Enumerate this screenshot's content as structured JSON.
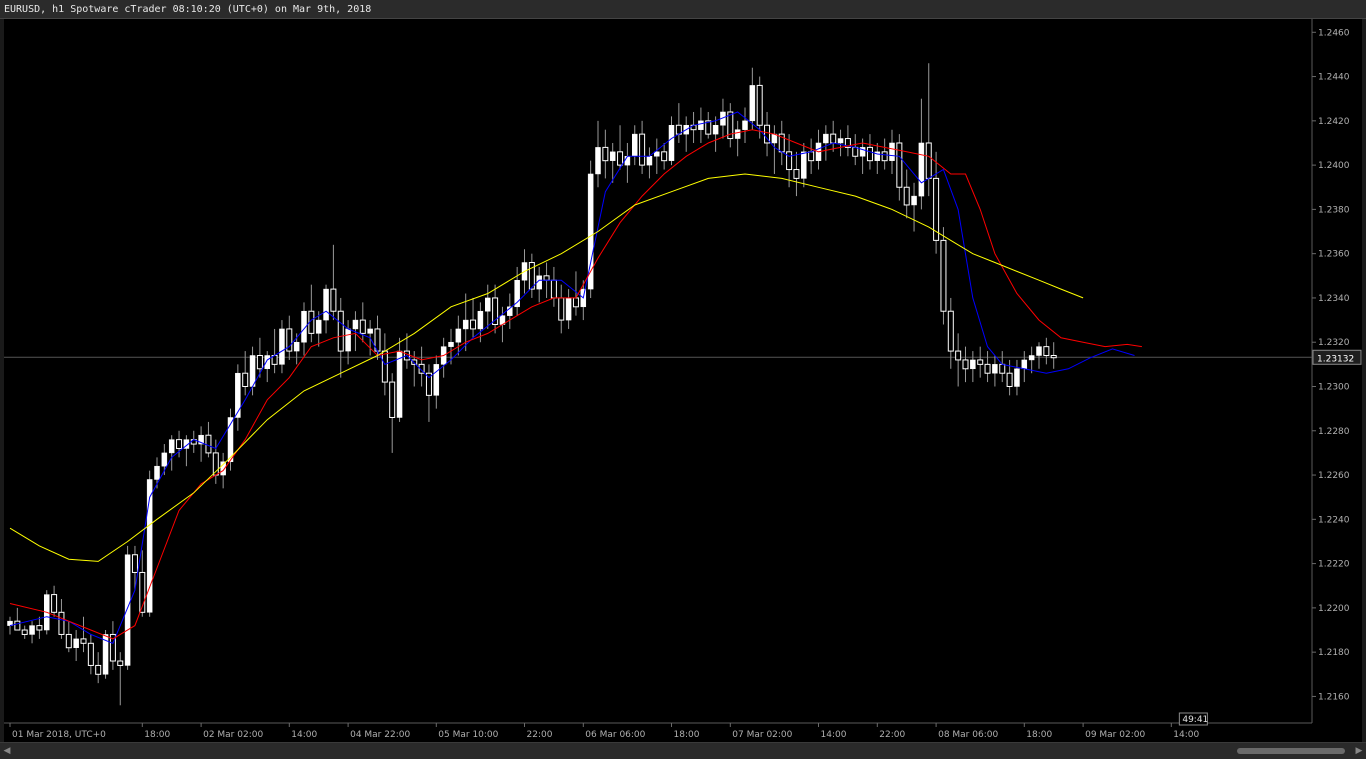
{
  "window": {
    "title": "EURUSD, h1 Spotware cTrader 08:10:20 (UTC+0) on Mar 9th, 2018"
  },
  "colors": {
    "background": "#000000",
    "up_candle": "#ffffff",
    "down_candle": "#ffffff",
    "wick": "#9a9a9a",
    "fast_ma": "#0000ff",
    "mid_ma": "#ff0000",
    "slow_ma": "#ffff00",
    "text": "#b0b0b0",
    "price_line": "#555555"
  },
  "price_label": "1.23132",
  "countdown": "49:41",
  "chart_data": {
    "type": "line",
    "title": "",
    "xlabel": "",
    "ylabel": "",
    "ylim": [
      1.2148,
      1.2466
    ],
    "x_range": [
      0,
      162
    ],
    "y_ticks": [
      "1.2460",
      "1.2440",
      "1.2420",
      "1.2400",
      "1.2380",
      "1.2360",
      "1.2340",
      "1.2320",
      "1.2300",
      "1.2280",
      "1.2260",
      "1.2240",
      "1.2220",
      "1.2200",
      "1.2180",
      "1.2160"
    ],
    "x_ticks": [
      {
        "index": 0,
        "label": "01 Mar 2018, UTC+0"
      },
      {
        "index": 18,
        "label": "18:00"
      },
      {
        "index": 26,
        "label": "02 Mar 02:00"
      },
      {
        "index": 38,
        "label": "14:00"
      },
      {
        "index": 46,
        "label": "04 Mar 22:00"
      },
      {
        "index": 58,
        "label": "05 Mar 10:00"
      },
      {
        "index": 70,
        "label": "22:00"
      },
      {
        "index": 78,
        "label": "06 Mar 06:00"
      },
      {
        "index": 90,
        "label": "18:00"
      },
      {
        "index": 98,
        "label": "07 Mar 02:00"
      },
      {
        "index": 110,
        "label": "14:00"
      },
      {
        "index": 118,
        "label": "22:00"
      },
      {
        "index": 126,
        "label": "08 Mar 06:00"
      },
      {
        "index": 138,
        "label": "18:00"
      },
      {
        "index": 146,
        "label": "09 Mar 02:00"
      },
      {
        "index": 158,
        "label": "14:00"
      }
    ],
    "current_price": 1.23132,
    "candles": [
      [
        1.2192,
        1.2196,
        1.2188,
        1.2194
      ],
      [
        1.2194,
        1.22,
        1.219,
        1.219
      ],
      [
        1.219,
        1.2192,
        1.2186,
        1.2188
      ],
      [
        1.2188,
        1.2194,
        1.2184,
        1.2192
      ],
      [
        1.2192,
        1.2196,
        1.2186,
        1.219
      ],
      [
        1.219,
        1.2208,
        1.2188,
        1.2206
      ],
      [
        1.2206,
        1.221,
        1.2196,
        1.2198
      ],
      [
        1.2198,
        1.2204,
        1.2186,
        1.2188
      ],
      [
        1.2188,
        1.2194,
        1.218,
        1.2182
      ],
      [
        1.2182,
        1.219,
        1.2176,
        1.2186
      ],
      [
        1.2186,
        1.2196,
        1.218,
        1.2184
      ],
      [
        1.2184,
        1.2188,
        1.217,
        1.2174
      ],
      [
        1.2174,
        1.218,
        1.2166,
        1.217
      ],
      [
        1.217,
        1.219,
        1.2168,
        1.2188
      ],
      [
        1.2188,
        1.2194,
        1.2172,
        1.2176
      ],
      [
        1.2176,
        1.218,
        1.2156,
        1.2174
      ],
      [
        1.2174,
        1.2228,
        1.2172,
        1.2224
      ],
      [
        1.2224,
        1.2228,
        1.2208,
        1.2216
      ],
      [
        1.2216,
        1.2226,
        1.2196,
        1.2198
      ],
      [
        1.2198,
        1.2262,
        1.2196,
        1.2258
      ],
      [
        1.2258,
        1.2268,
        1.2254,
        1.2264
      ],
      [
        1.2264,
        1.2274,
        1.226,
        1.227
      ],
      [
        1.227,
        1.2278,
        1.2262,
        1.2276
      ],
      [
        1.2276,
        1.228,
        1.2268,
        1.2272
      ],
      [
        1.2272,
        1.2278,
        1.2264,
        1.2276
      ],
      [
        1.2276,
        1.228,
        1.227,
        1.2274
      ],
      [
        1.2274,
        1.2282,
        1.2266,
        1.2278
      ],
      [
        1.2278,
        1.2284,
        1.2268,
        1.227
      ],
      [
        1.227,
        1.2276,
        1.2256,
        1.226
      ],
      [
        1.226,
        1.227,
        1.2254,
        1.2266
      ],
      [
        1.2266,
        1.229,
        1.2262,
        1.2286
      ],
      [
        1.2286,
        1.231,
        1.228,
        1.2306
      ],
      [
        1.2306,
        1.2316,
        1.2296,
        1.23
      ],
      [
        1.23,
        1.2318,
        1.2296,
        1.2314
      ],
      [
        1.2314,
        1.2322,
        1.2304,
        1.2308
      ],
      [
        1.2308,
        1.2316,
        1.2302,
        1.2314
      ],
      [
        1.2314,
        1.2326,
        1.2306,
        1.231
      ],
      [
        1.231,
        1.233,
        1.2306,
        1.2326
      ],
      [
        1.2326,
        1.2332,
        1.2312,
        1.2316
      ],
      [
        1.2316,
        1.2324,
        1.231,
        1.232
      ],
      [
        1.232,
        1.2338,
        1.2314,
        1.2334
      ],
      [
        1.2334,
        1.2346,
        1.232,
        1.2324
      ],
      [
        1.2324,
        1.2334,
        1.2318,
        1.233
      ],
      [
        1.233,
        1.2346,
        1.2324,
        1.2344
      ],
      [
        1.2344,
        1.2364,
        1.233,
        1.2334
      ],
      [
        1.2334,
        1.234,
        1.2304,
        1.2316
      ],
      [
        1.2316,
        1.233,
        1.231,
        1.2326
      ],
      [
        1.2326,
        1.2334,
        1.2316,
        1.233
      ],
      [
        1.233,
        1.2338,
        1.232,
        1.2324
      ],
      [
        1.2324,
        1.233,
        1.2314,
        1.2326
      ],
      [
        1.2326,
        1.2332,
        1.2312,
        1.2316
      ],
      [
        1.2316,
        1.2324,
        1.2296,
        1.2302
      ],
      [
        1.2302,
        1.2306,
        1.227,
        1.2286
      ],
      [
        1.2286,
        1.2322,
        1.2284,
        1.2316
      ],
      [
        1.2316,
        1.2324,
        1.2308,
        1.2312
      ],
      [
        1.2312,
        1.2316,
        1.23,
        1.231
      ],
      [
        1.231,
        1.2318,
        1.23,
        1.2306
      ],
      [
        1.2306,
        1.231,
        1.2284,
        1.2296
      ],
      [
        1.2296,
        1.2314,
        1.229,
        1.231
      ],
      [
        1.231,
        1.2322,
        1.2304,
        1.2318
      ],
      [
        1.2318,
        1.2326,
        1.231,
        1.232
      ],
      [
        1.232,
        1.2332,
        1.2314,
        1.2326
      ],
      [
        1.2326,
        1.2342,
        1.2316,
        1.233
      ],
      [
        1.233,
        1.234,
        1.2322,
        1.2326
      ],
      [
        1.2326,
        1.2338,
        1.232,
        1.2334
      ],
      [
        1.2334,
        1.2346,
        1.2326,
        1.234
      ],
      [
        1.234,
        1.2346,
        1.2324,
        1.2328
      ],
      [
        1.2328,
        1.2336,
        1.232,
        1.2332
      ],
      [
        1.2332,
        1.2342,
        1.2326,
        1.2336
      ],
      [
        1.2336,
        1.2354,
        1.2332,
        1.2348
      ],
      [
        1.2348,
        1.2362,
        1.2342,
        1.2356
      ],
      [
        1.2356,
        1.236,
        1.234,
        1.2344
      ],
      [
        1.2344,
        1.2354,
        1.2338,
        1.235
      ],
      [
        1.235,
        1.2356,
        1.234,
        1.2348
      ],
      [
        1.2348,
        1.2354,
        1.2336,
        1.234
      ],
      [
        1.234,
        1.2346,
        1.2324,
        1.233
      ],
      [
        1.233,
        1.2344,
        1.2326,
        1.234
      ],
      [
        1.234,
        1.2352,
        1.2332,
        1.2336
      ],
      [
        1.2336,
        1.2348,
        1.233,
        1.2344
      ],
      [
        1.2344,
        1.2402,
        1.234,
        1.2396
      ],
      [
        1.2396,
        1.242,
        1.239,
        1.2408
      ],
      [
        1.2408,
        1.2416,
        1.2394,
        1.2402
      ],
      [
        1.2402,
        1.241,
        1.2392,
        1.2406
      ],
      [
        1.2406,
        1.2418,
        1.2398,
        1.24
      ],
      [
        1.24,
        1.241,
        1.2392,
        1.2404
      ],
      [
        1.2404,
        1.2418,
        1.24,
        1.2414
      ],
      [
        1.2414,
        1.242,
        1.2396,
        1.24
      ],
      [
        1.24,
        1.2408,
        1.2394,
        1.2404
      ],
      [
        1.2404,
        1.2412,
        1.2396,
        1.2406
      ],
      [
        1.2406,
        1.241,
        1.2398,
        1.2402
      ],
      [
        1.2402,
        1.2422,
        1.24,
        1.2418
      ],
      [
        1.2418,
        1.2428,
        1.241,
        1.2414
      ],
      [
        1.2414,
        1.2422,
        1.2406,
        1.2418
      ],
      [
        1.2418,
        1.2424,
        1.241,
        1.2416
      ],
      [
        1.2416,
        1.2426,
        1.241,
        1.242
      ],
      [
        1.242,
        1.2424,
        1.2412,
        1.2414
      ],
      [
        1.2414,
        1.2422,
        1.2406,
        1.2418
      ],
      [
        1.2418,
        1.243,
        1.2412,
        1.2424
      ],
      [
        1.2424,
        1.2428,
        1.2408,
        1.2412
      ],
      [
        1.2412,
        1.242,
        1.2404,
        1.2416
      ],
      [
        1.2416,
        1.2426,
        1.241,
        1.242
      ],
      [
        1.242,
        1.2444,
        1.2416,
        1.2436
      ],
      [
        1.2436,
        1.244,
        1.2412,
        1.2418
      ],
      [
        1.2418,
        1.2424,
        1.2404,
        1.241
      ],
      [
        1.241,
        1.2418,
        1.2396,
        1.2414
      ],
      [
        1.2414,
        1.242,
        1.24,
        1.2406
      ],
      [
        1.2406,
        1.2414,
        1.239,
        1.2398
      ],
      [
        1.2398,
        1.2406,
        1.2386,
        1.2394
      ],
      [
        1.2394,
        1.241,
        1.239,
        1.2406
      ],
      [
        1.2406,
        1.2412,
        1.2396,
        1.2402
      ],
      [
        1.2402,
        1.2416,
        1.2398,
        1.241
      ],
      [
        1.241,
        1.2418,
        1.2402,
        1.2414
      ],
      [
        1.2414,
        1.242,
        1.2406,
        1.241
      ],
      [
        1.241,
        1.2416,
        1.2404,
        1.2412
      ],
      [
        1.2412,
        1.2418,
        1.2404,
        1.2408
      ],
      [
        1.2408,
        1.2414,
        1.24,
        1.2404
      ],
      [
        1.2404,
        1.2412,
        1.2396,
        1.2408
      ],
      [
        1.2408,
        1.2414,
        1.2398,
        1.2402
      ],
      [
        1.2402,
        1.241,
        1.2396,
        1.2406
      ],
      [
        1.2406,
        1.2412,
        1.2398,
        1.2402
      ],
      [
        1.2402,
        1.2416,
        1.2396,
        1.241
      ],
      [
        1.241,
        1.2414,
        1.2384,
        1.239
      ],
      [
        1.239,
        1.2398,
        1.2376,
        1.2382
      ],
      [
        1.2382,
        1.2392,
        1.237,
        1.2386
      ],
      [
        1.2386,
        1.243,
        1.238,
        1.241
      ],
      [
        1.241,
        1.2446,
        1.2386,
        1.2394
      ],
      [
        1.2394,
        1.2406,
        1.236,
        1.2366
      ],
      [
        1.2366,
        1.2372,
        1.2328,
        1.2334
      ],
      [
        1.2334,
        1.234,
        1.2308,
        1.2316
      ],
      [
        1.2316,
        1.2324,
        1.23,
        1.2312
      ],
      [
        1.2312,
        1.2318,
        1.2302,
        1.2308
      ],
      [
        1.2308,
        1.2316,
        1.2302,
        1.2312
      ],
      [
        1.2312,
        1.2318,
        1.2304,
        1.231
      ],
      [
        1.231,
        1.2316,
        1.2302,
        1.2306
      ],
      [
        1.2306,
        1.2314,
        1.23,
        1.231
      ],
      [
        1.231,
        1.2316,
        1.2302,
        1.2306
      ],
      [
        1.2306,
        1.2312,
        1.2296,
        1.23
      ],
      [
        1.23,
        1.2312,
        1.2296,
        1.2308
      ],
      [
        1.2308,
        1.2316,
        1.2302,
        1.2312
      ],
      [
        1.2312,
        1.2318,
        1.2306,
        1.2314
      ],
      [
        1.2314,
        1.232,
        1.2308,
        1.2318
      ],
      [
        1.2318,
        1.2322,
        1.231,
        1.2314
      ],
      [
        1.2314,
        1.232,
        1.2308,
        1.2313
      ]
    ],
    "series": [
      {
        "color": "#0000ff",
        "x": [
          0,
          5,
          8,
          11,
          14,
          17,
          19,
          22,
          25,
          28,
          32,
          35,
          38,
          41,
          43,
          46,
          49,
          51,
          54,
          57,
          60,
          63,
          66,
          69,
          72,
          75,
          78,
          81,
          84,
          87,
          90,
          93,
          96,
          99,
          102,
          104,
          106,
          109,
          112,
          115,
          118,
          121,
          124,
          127,
          129,
          131,
          133,
          135,
          138,
          141,
          144,
          147,
          150,
          153
        ],
        "values": [
          1.2192,
          1.2196,
          1.2194,
          1.2188,
          1.2184,
          1.2208,
          1.225,
          1.2268,
          1.2276,
          1.2272,
          1.2294,
          1.2312,
          1.2318,
          1.233,
          1.2334,
          1.2326,
          1.2322,
          1.231,
          1.2314,
          1.2304,
          1.2312,
          1.2322,
          1.233,
          1.2338,
          1.2348,
          1.2348,
          1.234,
          1.2388,
          1.2404,
          1.2404,
          1.2412,
          1.2418,
          1.242,
          1.2424,
          1.2416,
          1.2408,
          1.2404,
          1.2406,
          1.241,
          1.2408,
          1.2405,
          1.2404,
          1.2392,
          1.2398,
          1.238,
          1.234,
          1.2318,
          1.231,
          1.2308,
          1.2306,
          1.2308,
          1.2313,
          1.2317,
          1.2314
        ]
      },
      {
        "color": "#ff0000",
        "x": [
          0,
          5,
          8,
          11,
          14,
          17,
          20,
          23,
          26,
          29,
          32,
          35,
          38,
          41,
          44,
          47,
          50,
          53,
          56,
          59,
          62,
          65,
          68,
          71,
          74,
          77,
          80,
          83,
          86,
          89,
          92,
          95,
          98,
          101,
          104,
          107,
          110,
          113,
          116,
          119,
          122,
          125,
          128,
          130,
          132,
          134,
          137,
          140,
          143,
          146,
          149,
          152,
          154
        ],
        "values": [
          1.2202,
          1.2198,
          1.2194,
          1.219,
          1.2186,
          1.2192,
          1.2218,
          1.2244,
          1.2256,
          1.2262,
          1.2276,
          1.2294,
          1.2304,
          1.2318,
          1.2322,
          1.2324,
          1.2314,
          1.2316,
          1.2312,
          1.2314,
          1.232,
          1.2324,
          1.233,
          1.2336,
          1.234,
          1.234,
          1.2358,
          1.2374,
          1.2386,
          1.2396,
          1.2404,
          1.241,
          1.2414,
          1.2416,
          1.2414,
          1.241,
          1.2406,
          1.2408,
          1.241,
          1.2408,
          1.2406,
          1.2404,
          1.2396,
          1.2396,
          1.238,
          1.236,
          1.2342,
          1.233,
          1.2322,
          1.232,
          1.2318,
          1.2319,
          1.2318
        ]
      },
      {
        "color": "#ffff00",
        "x": [
          0,
          4,
          8,
          12,
          16,
          20,
          25,
          30,
          35,
          40,
          45,
          50,
          55,
          60,
          65,
          70,
          75,
          80,
          85,
          90,
          95,
          100,
          105,
          110,
          115,
          120,
          125,
          128,
          131,
          134,
          137,
          140,
          143,
          146
        ],
        "values": [
          1.2236,
          1.2228,
          1.2222,
          1.2221,
          1.223,
          1.224,
          1.2252,
          1.2268,
          1.2285,
          1.2298,
          1.2306,
          1.2314,
          1.2324,
          1.2336,
          1.2342,
          1.2352,
          1.236,
          1.237,
          1.2382,
          1.2388,
          1.2394,
          1.2396,
          1.2394,
          1.239,
          1.2386,
          1.238,
          1.2372,
          1.2366,
          1.236,
          1.2356,
          1.2352,
          1.2348,
          1.2344,
          1.234
        ]
      }
    ],
    "grid": false,
    "legend": "none"
  }
}
